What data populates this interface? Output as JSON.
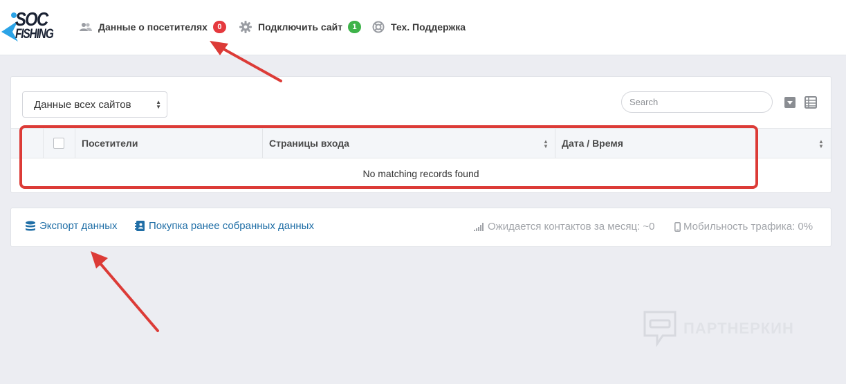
{
  "logo": {
    "line1": "SOC",
    "line2": "FISHING"
  },
  "nav": [
    {
      "label": "Данные о посетителях",
      "badge": "0",
      "badge_color": "#e5393e",
      "icon": "users-icon"
    },
    {
      "label": "Подключить сайт",
      "badge": "1",
      "badge_color": "#3eb34a",
      "icon": "gear-icon"
    },
    {
      "label": "Тех. Поддержка",
      "icon": "lifebuoy-icon"
    }
  ],
  "filter": {
    "selected": "Данные всех сайтов"
  },
  "search": {
    "placeholder": "Search"
  },
  "table": {
    "columns": [
      "Посетители",
      "Страницы входа",
      "Дата / Время"
    ],
    "empty_message": "No matching records found"
  },
  "footer": {
    "export_label": "Экспорт данных",
    "purchase_label": "Покупка ранее собранных данных",
    "contacts_label": "Ожидается контактов за месяц: ~0",
    "mobility_label": "Мобильность трафика: 0%"
  },
  "watermark": {
    "text": "ПАРТНЕРКИН"
  },
  "colors": {
    "accent_link": "#1f6ea6",
    "highlight": "#dc3b37",
    "badge_red": "#e5393e",
    "badge_green": "#3eb34a"
  }
}
